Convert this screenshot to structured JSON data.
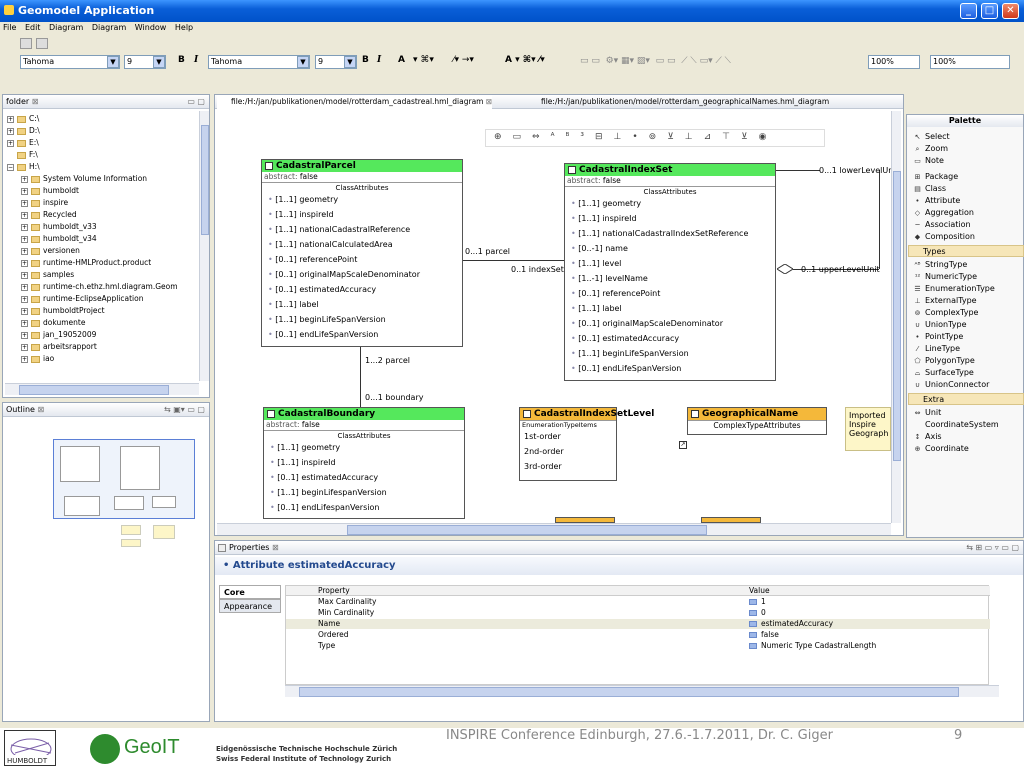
{
  "window": {
    "title": "Geomodel Application"
  },
  "menu": [
    "File",
    "Edit",
    "Diagram",
    "Diagram",
    "Window",
    "Help"
  ],
  "toolbar": {
    "font1": "Tahoma",
    "size1": "9",
    "font2": "Tahoma",
    "size2": "9",
    "zoom1": "100%",
    "zoom2": "100%",
    "bold": "B",
    "italic": "I",
    "fontcolor": "A"
  },
  "folder_panel": {
    "title": "folder",
    "items": [
      "C:\\",
      "D:\\",
      "E:\\",
      "F:\\",
      "H:\\",
      "System Volume Information",
      "humboldt",
      "inspire",
      "Recycled",
      "humboldt_v33",
      "humboldt_v34",
      "versionen",
      "runtime-HMLProduct.product",
      "samples",
      "runtime-ch.ethz.hml.diagram.Geom",
      "runtime-EclipseApplication",
      "humboldtProject",
      "dokumente",
      "jan_19052009",
      "arbeitsrapport",
      "iao"
    ]
  },
  "outline_panel": {
    "title": "Outline"
  },
  "editor": {
    "tabs": [
      "file:/H:/jan/publikationen/model/rotterdam_cadastreal.hml_diagram",
      "file:/H:/jan/publikationen/model/rotterdam_geographicalNames.hml_diagram"
    ]
  },
  "diagram": {
    "cadastral_parcel": {
      "name": "CadastralParcel",
      "abstract_label": "abstract:",
      "abstract_value": "false",
      "section": "ClassAttributes",
      "attrs": [
        "[1..1] geometry",
        "[1..1] inspireId",
        "[1..1] nationalCadastralReference",
        "[1..1] nationalCalculatedArea",
        "[0..1] referencePoint",
        "[0..1] originalMapScaleDenominator",
        "[0..1] estimatedAccuracy",
        "[1..1] label",
        "[1..1] beginLifeSpanVersion",
        "[0..1] endLifeSpanVersion"
      ]
    },
    "cadastral_index_set": {
      "name": "CadastralIndexSet",
      "abstract_label": "abstract:",
      "abstract_value": "false",
      "section": "ClassAttributes",
      "attrs": [
        "[1..1] geometry",
        "[1..1] inspireId",
        "[1..1] nationalCadastralIndexSetReference",
        "[0..-1] name",
        "[1..1] level",
        "[1..-1] levelName",
        "[0..1] referencePoint",
        "[1..1] label",
        "[0..1] originalMapScaleDenominator",
        "[0..1] estimatedAccuracy",
        "[1..1] beginLifeSpanVersion",
        "[0..1] endLifeSpanVersion"
      ]
    },
    "cadastral_boundary": {
      "name": "CadastralBoundary",
      "abstract_label": "abstract:",
      "abstract_value": "false",
      "section": "ClassAttributes",
      "attrs": [
        "[1..1] geometry",
        "[1..1] inspireId",
        "[0..1] estimatedAccuracy",
        "[1..1] beginLifespanVersion",
        "[0..1] endLifespanVersion"
      ]
    },
    "cadastral_index_set_level": {
      "name": "CadastralIndexSetLevel",
      "section": "EnumerationTypeItems",
      "items": [
        "1st-order",
        "2nd-order",
        "3rd-order"
      ]
    },
    "geographical_name": {
      "name": "GeographicalName",
      "section": "ComplexTypeAttributes"
    },
    "note": [
      "Imported",
      "Inspire",
      "Geograph"
    ],
    "labels": {
      "lower_level": "0...1 lowerLevelUnit",
      "upper_level": "0..1 upperLevelUnit",
      "parcel_a": "0...1 parcel",
      "index_set": "0..1 indexSet",
      "parcel_b": "1...2 parcel",
      "boundary": "0...1 boundary"
    }
  },
  "palette": {
    "title": "Palette",
    "tools": [
      "Select",
      "Zoom",
      "Note"
    ],
    "general": [
      "Package",
      "Class",
      "Attribute",
      "Aggregation",
      "Association",
      "Composition"
    ],
    "types_title": "Types",
    "types": [
      "StringType",
      "NumericType",
      "EnumerationType",
      "ExternalType",
      "ComplexType",
      "UnionType",
      "PointType",
      "LineType",
      "PolygonType",
      "SurfaceType",
      "UnionConnector"
    ],
    "extra_title": "Extra",
    "extra": [
      "Unit",
      "CoordinateSystem",
      "Axis",
      "Coordinate"
    ]
  },
  "properties": {
    "title": "Properties",
    "heading": "Attribute estimatedAccuracy",
    "tabs": [
      "Core",
      "Appearance"
    ],
    "col_property": "Property",
    "col_value": "Value",
    "rows": [
      {
        "k": "Max Cardinality",
        "v": "1"
      },
      {
        "k": "Min Cardinality",
        "v": "0"
      },
      {
        "k": "Name",
        "v": "estimatedAccuracy"
      },
      {
        "k": "Ordered",
        "v": "false"
      },
      {
        "k": "Type",
        "v": "Numeric Type CadastralLength"
      }
    ]
  },
  "footer": {
    "text": "INSPIRE Conference Edinburgh, 27.6.-1.7.2011, Dr. C. Giger",
    "page": "9",
    "geoit": "GeoIT",
    "eth_line1": "Eidgenössische Technische Hochschule Zürich",
    "eth_line2": "Swiss Federal Institute of Technology Zurich",
    "humboldt": "HUMBOLDT"
  }
}
